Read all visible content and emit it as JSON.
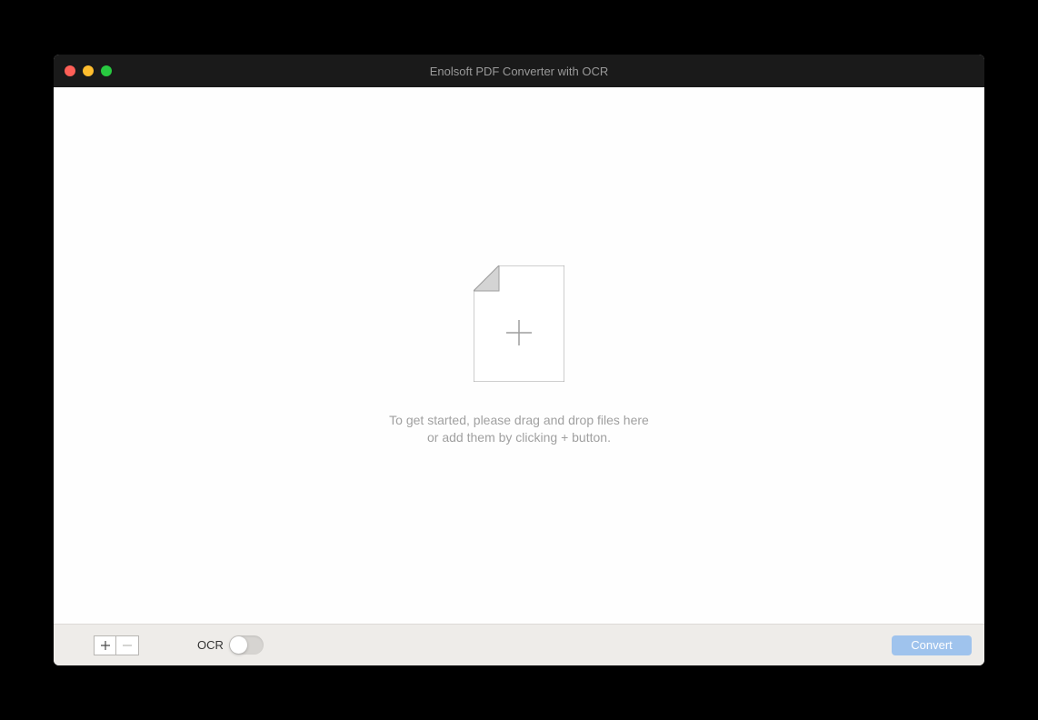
{
  "window": {
    "title": "Enolsoft PDF Converter with OCR"
  },
  "dropzone": {
    "hint_line1": "To get started, please drag and drop files here",
    "hint_line2": "or add them by clicking + button."
  },
  "footer": {
    "ocr_label": "OCR",
    "ocr_enabled": false,
    "convert_label": "Convert"
  }
}
